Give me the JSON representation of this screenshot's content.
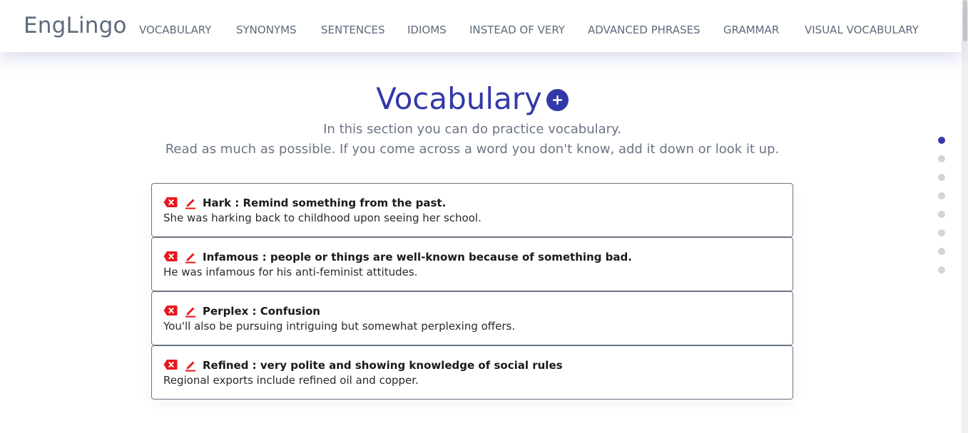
{
  "brand": "EngLingo",
  "nav": [
    "VOCABULARY",
    "SYNONYMS",
    "SENTENCES",
    "IDIOMS",
    "INSTEAD OF VERY",
    "ADVANCED PHRASES",
    "GRAMMAR",
    "VISUAL VOCABULARY"
  ],
  "section": {
    "title": "Vocabulary",
    "add_icon": "plus-circle-icon",
    "subtitle_line1": "In this section you can do practice vocabulary.",
    "subtitle_line2": "Read as much as possible. If you come across a word you don't know, add it down or look it up."
  },
  "entries": [
    {
      "heading": "Hark : Remind something from the past.",
      "example": "She was harking back to childhood upon seeing her school."
    },
    {
      "heading": "Infamous : people or things are well-known because of something bad.",
      "example": "He was infamous for his anti-feminist attitudes."
    },
    {
      "heading": "Perplex : Confusion",
      "example": "You'll also be pursuing intriguing but somewhat perplexing offers."
    },
    {
      "heading": "Refined : very polite and showing knowledge of social rules",
      "example": "Regional exports include refined oil and copper."
    }
  ],
  "icons": {
    "delete": "delete-icon",
    "edit": "pencil-icon"
  },
  "pagination": {
    "total": 8,
    "active_index": 0
  },
  "colors": {
    "accent": "#3338a8",
    "nav_text": "#5e6a7d",
    "icon_red": "#e8161c",
    "dot_inactive": "#d4d4d4"
  }
}
